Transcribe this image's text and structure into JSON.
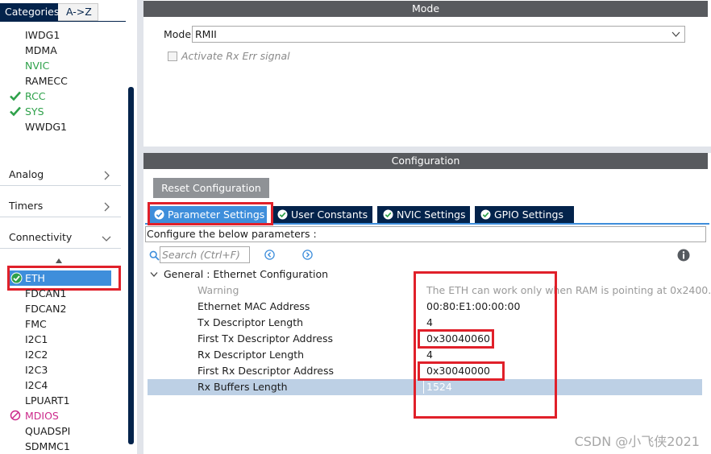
{
  "left_panel": {
    "tabs": {
      "categories": "Categories",
      "az": "A->Z"
    },
    "system_items": [
      {
        "label": "IWDG1",
        "status": "none"
      },
      {
        "label": "MDMA",
        "status": "none"
      },
      {
        "label": "NVIC",
        "status": "green"
      },
      {
        "label": "RAMECC",
        "status": "none"
      },
      {
        "label": "RCC",
        "status": "checked"
      },
      {
        "label": "SYS",
        "status": "checked"
      },
      {
        "label": "WWDG1",
        "status": "none"
      }
    ],
    "groups": {
      "analog": "Analog",
      "timers": "Timers",
      "connectivity": "Connectivity"
    },
    "connectivity_items": [
      {
        "label": "ETH",
        "status": "selected"
      },
      {
        "label": "FDCAN1",
        "status": "none"
      },
      {
        "label": "FDCAN2",
        "status": "none"
      },
      {
        "label": "FMC",
        "status": "none"
      },
      {
        "label": "I2C1",
        "status": "none"
      },
      {
        "label": "I2C2",
        "status": "none"
      },
      {
        "label": "I2C3",
        "status": "none"
      },
      {
        "label": "I2C4",
        "status": "none"
      },
      {
        "label": "LPUART1",
        "status": "none"
      },
      {
        "label": "MDIOS",
        "status": "disabled"
      },
      {
        "label": "QUADSPI",
        "status": "none"
      },
      {
        "label": "SDMMC1",
        "status": "none"
      }
    ]
  },
  "mode_section": {
    "title": "Mode",
    "mode_label": "Mode",
    "mode_value": "RMII",
    "rx_err_label": "Activate Rx Err signal"
  },
  "config_section": {
    "title": "Configuration",
    "reset_label": "Reset Configuration",
    "tabs": [
      "Parameter Settings",
      "User Constants",
      "NVIC Settings",
      "GPIO Settings"
    ],
    "description": "Configure the below parameters :",
    "search_placeholder": "Search (Ctrl+F)",
    "group_title": "General : Ethernet Configuration",
    "params": [
      {
        "name": "Warning",
        "value": "The ETH can work only when RAM is pointing at 0x2400..."
      },
      {
        "name": "Ethernet MAC Address",
        "value": "00:80:E1:00:00:00"
      },
      {
        "name": "Tx Descriptor Length",
        "value": "4"
      },
      {
        "name": "First Tx Descriptor Address",
        "value": "0x30040060"
      },
      {
        "name": "Rx Descriptor Length",
        "value": "4"
      },
      {
        "name": "First Rx Descriptor Address",
        "value": "0x30040000"
      },
      {
        "name": "Rx Buffers Length",
        "value": "1524"
      }
    ]
  },
  "watermark": "CSDN @小飞侠2021",
  "colors": {
    "navy": "#03234b",
    "accent_blue": "#3e8edb",
    "section_bar": "#585a5e",
    "ok_green": "#2ea14a",
    "disabled_magenta": "#cc2a8b",
    "highlight_red": "#e0202a",
    "selected_row": "#bdd0e5"
  },
  "icons": [
    "check-icon",
    "disabled-circle-icon",
    "chevron-right-icon",
    "chevron-down-icon",
    "triangle-up-icon",
    "search-icon",
    "arrow-left-circle-icon",
    "arrow-right-circle-icon",
    "info-icon",
    "dropdown-arrow-icon"
  ]
}
